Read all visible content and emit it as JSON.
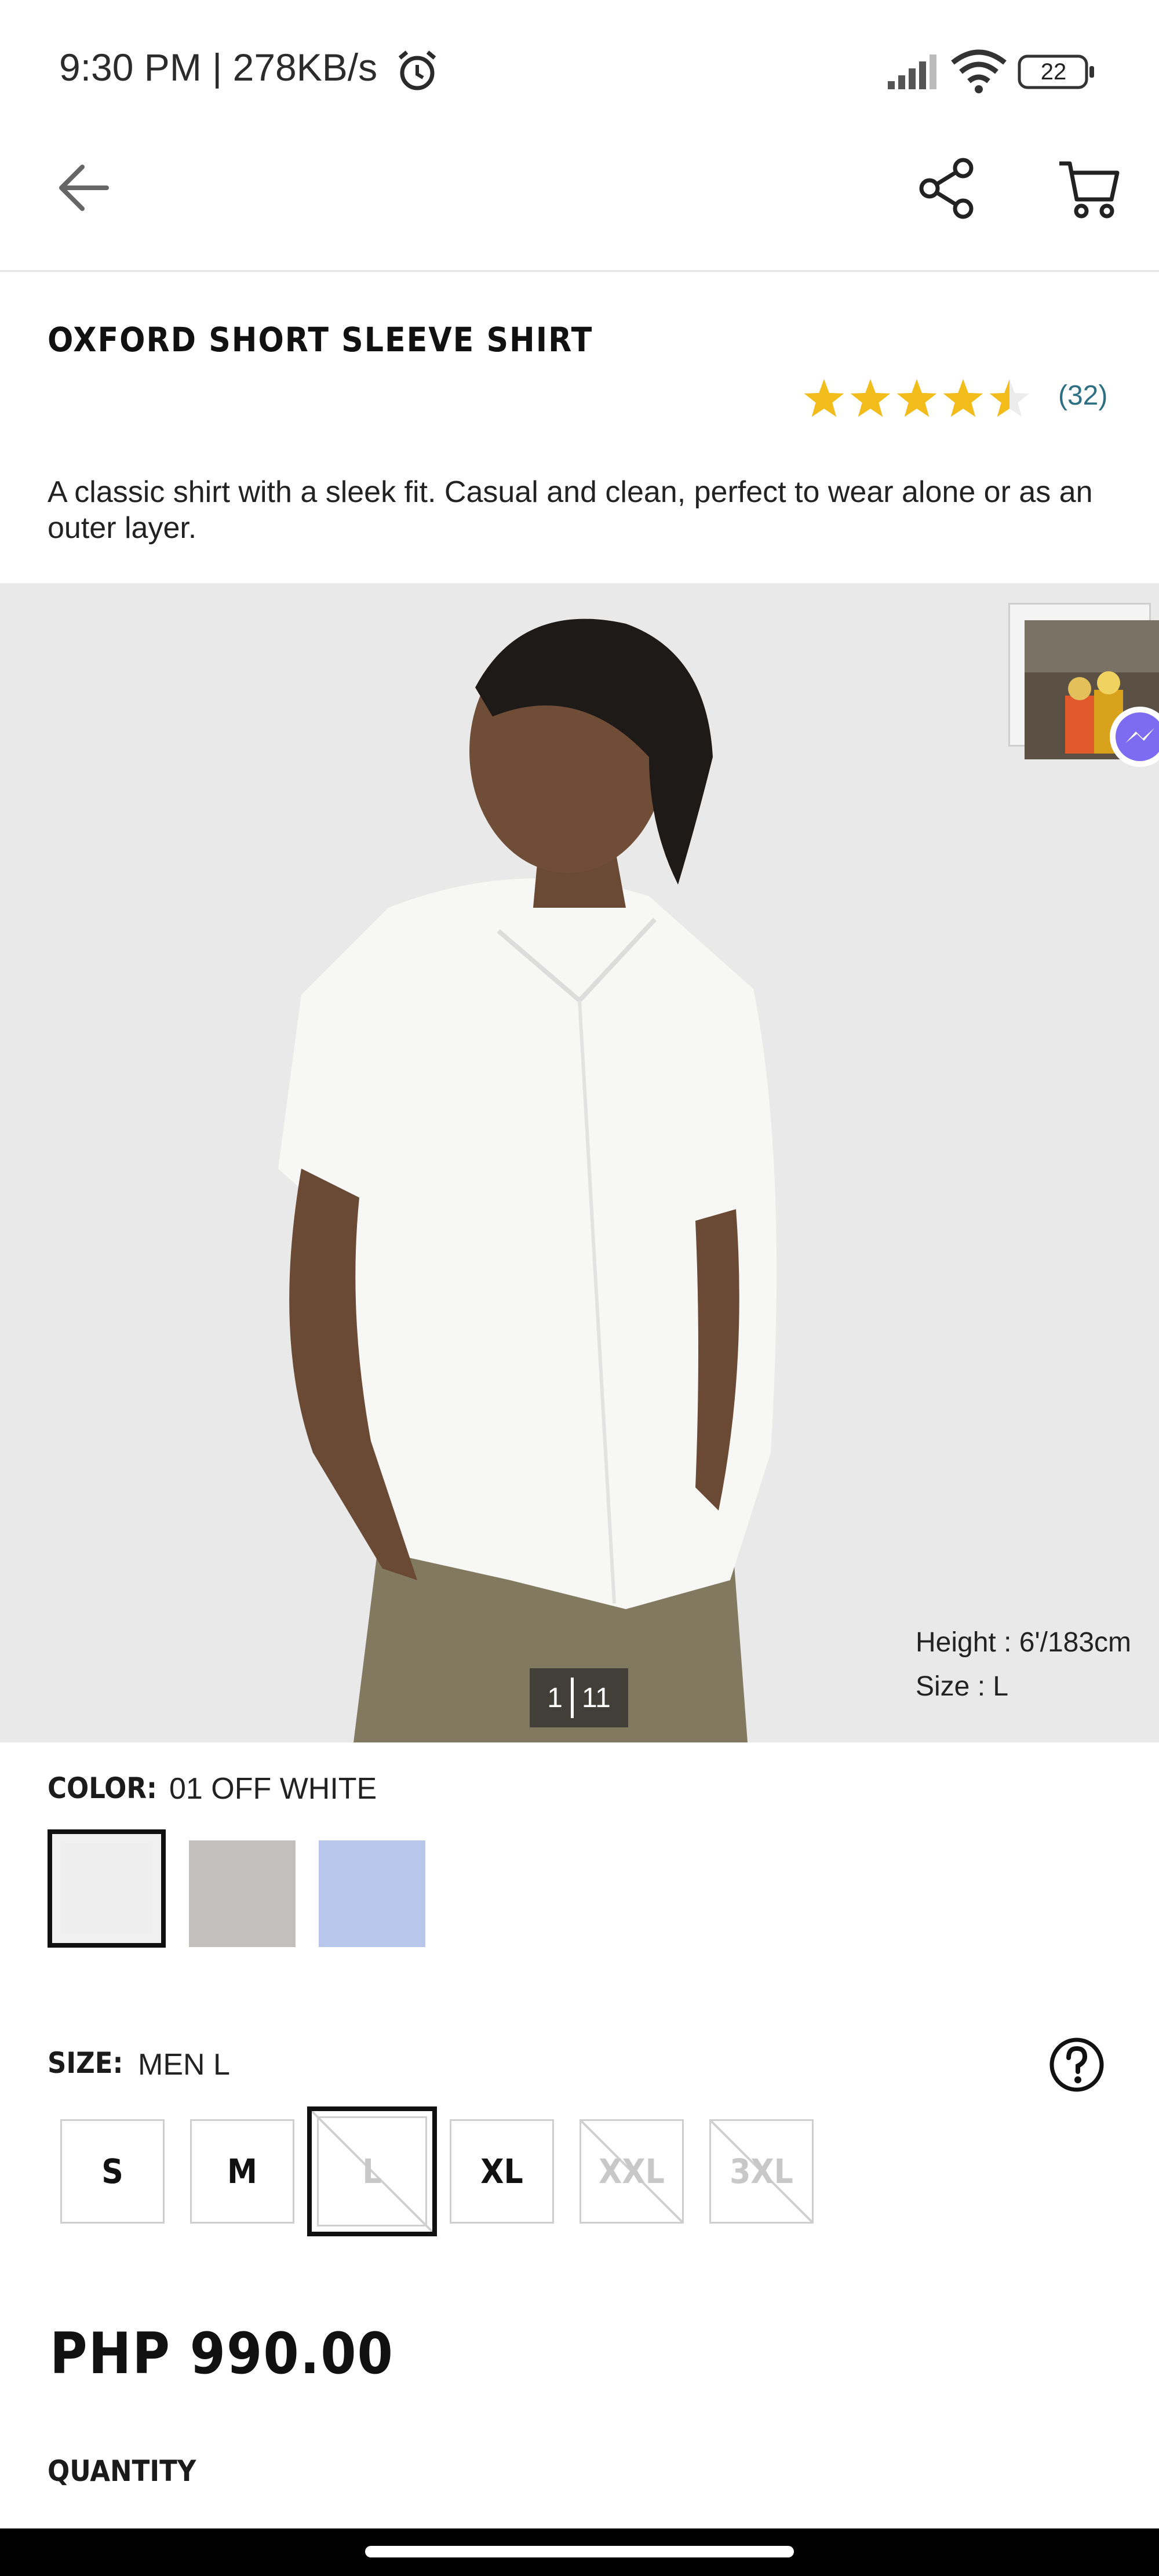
{
  "status_bar": {
    "time_text": "9:30 PM | 278KB/s",
    "battery": "22"
  },
  "product": {
    "title": "OXFORD SHORT SLEEVE SHIRT",
    "rating": 4.5,
    "review_count": "(32)",
    "description": "A classic shirt with a sleek fit. Casual and clean, perfect to wear alone or as an outer layer."
  },
  "gallery": {
    "current": "1",
    "total": "11",
    "model_height": "Height : 6'/183cm",
    "model_size": "Size : L"
  },
  "color": {
    "label": "COLOR:",
    "value": "01 OFF WHITE",
    "swatches": [
      "#eeeeee",
      "#c2c0bf",
      "#b8c6ec"
    ]
  },
  "size": {
    "label": "SIZE:",
    "value": "MEN L",
    "options": [
      {
        "label": "S",
        "available": true
      },
      {
        "label": "M",
        "available": true
      },
      {
        "label": "L",
        "available": false,
        "selected": true
      },
      {
        "label": "XL",
        "available": true
      },
      {
        "label": "XXL",
        "available": false
      },
      {
        "label": "3XL",
        "available": false
      }
    ]
  },
  "price": "PHP 990.00",
  "quantity_label": "QUANTITY",
  "colors": {
    "star": "#f2bc1a",
    "review_link": "#2d6f83"
  }
}
